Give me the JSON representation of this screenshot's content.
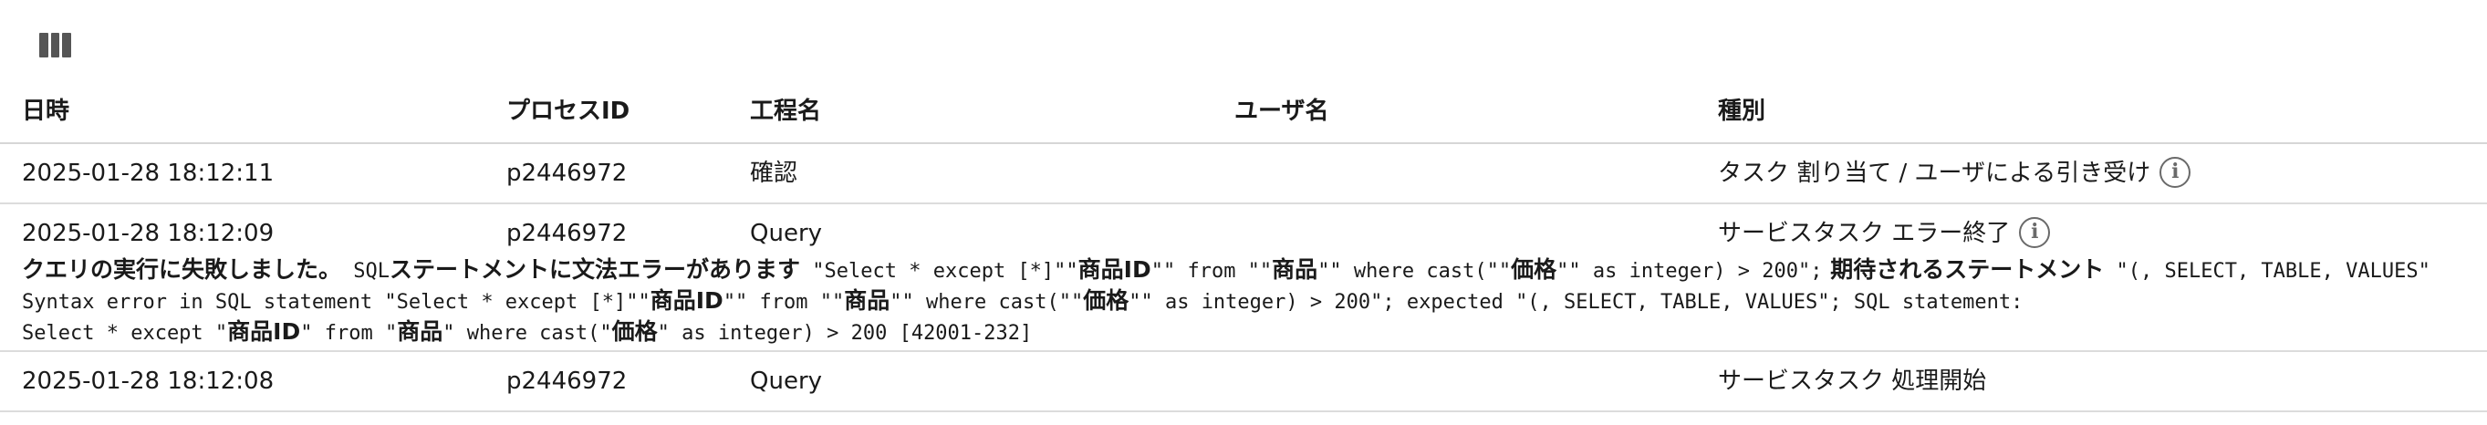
{
  "toolbar": {
    "columns_icon": "columns-icon"
  },
  "table": {
    "headers": {
      "datetime": "日時",
      "process_id": "プロセスID",
      "step": "工程名",
      "user": "ユーザ名",
      "kind": "種別"
    },
    "rows": [
      {
        "datetime": "2025-01-28 18:12:11",
        "process_id": "p2446972",
        "step": "確認",
        "user": "",
        "kind": "タスク 割り当て / ユーザによる引き受け",
        "info_icon": "info-icon"
      },
      {
        "datetime": "2025-01-28 18:12:09",
        "process_id": "p2446972",
        "step": "Query",
        "user": "",
        "kind": "サービスタスク エラー終了",
        "info_icon": "info-icon",
        "error": {
          "line1_jp1": "クエリの実行に失敗しました。",
          "line1_mono1": " SQL",
          "line1_jp2": "ステートメントに文法エラーがあります",
          "line1_mono2": " \"Select * except [*]\"\"",
          "line1_jp3": "商品ID",
          "line1_mono3": "\"\" from \"\"",
          "line1_jp4": "商品",
          "line1_mono4": "\"\" where cast(\"\"",
          "line1_jp5": "価格",
          "line1_mono5": "\"\" as integer) > 200\";",
          "line1_jp6": " 期待されるステートメント",
          "line1_mono6": " \"(, SELECT, TABLE, VALUES\"",
          "line2_mono1": "Syntax error in SQL statement \"Select * except [*]\"\"",
          "line2_jp1": "商品ID",
          "line2_mono2": "\"\" from \"\"",
          "line2_jp2": "商品",
          "line2_mono3": "\"\" where cast(\"\"",
          "line2_jp3": "価格",
          "line2_mono4": "\"\" as integer) > 200\"; expected \"(, SELECT, TABLE, VALUES\"; SQL statement:",
          "line3_mono1": "Select * except \"",
          "line3_jp1": "商品ID",
          "line3_mono2": "\" from \"",
          "line3_jp2": "商品",
          "line3_mono3": "\" where cast(\"",
          "line3_jp3": "価格",
          "line3_mono4": "\" as integer) > 200 [42001-232]"
        }
      },
      {
        "datetime": "2025-01-28 18:12:08",
        "process_id": "p2446972",
        "step": "Query",
        "user": "",
        "kind": "サービスタスク 処理開始"
      }
    ]
  }
}
